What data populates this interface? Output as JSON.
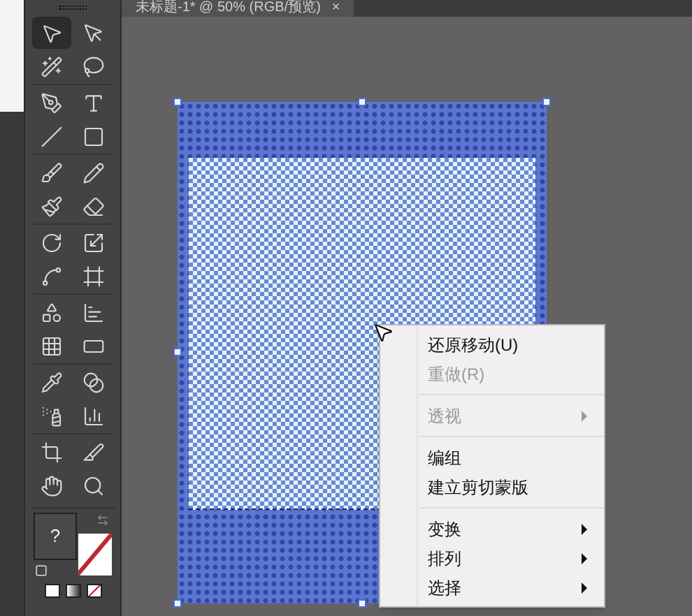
{
  "document_tab": {
    "title": "未标题-1* @ 50% (RGB/预览)",
    "close": "×"
  },
  "tools": [
    {
      "selected": true
    },
    {
      "selected": false
    },
    {
      "selected": false
    },
    {
      "selected": false
    },
    {
      "selected": false
    },
    {
      "selected": false
    },
    {
      "selected": false
    },
    {
      "selected": false
    },
    {
      "selected": false
    },
    {
      "selected": false
    },
    {
      "selected": false
    },
    {
      "selected": false
    },
    {
      "selected": false
    },
    {
      "selected": false
    },
    {
      "selected": false
    },
    {
      "selected": false
    },
    {
      "selected": false
    },
    {
      "selected": false
    },
    {
      "selected": false
    },
    {
      "selected": false
    },
    {
      "selected": false
    },
    {
      "selected": false
    },
    {
      "selected": false
    },
    {
      "selected": false
    },
    {
      "selected": false
    },
    {
      "selected": false
    },
    {
      "selected": false
    },
    {
      "selected": false
    }
  ],
  "fill": {
    "label": "?"
  },
  "context_menu": [
    {
      "kind": "item",
      "label": "还原移动(U)",
      "disabled": false,
      "submenu": false
    },
    {
      "kind": "item",
      "label": "重做(R)",
      "disabled": true,
      "submenu": false
    },
    {
      "kind": "separator"
    },
    {
      "kind": "item",
      "label": "透视",
      "disabled": true,
      "submenu": true
    },
    {
      "kind": "separator"
    },
    {
      "kind": "item",
      "label": "编组",
      "disabled": false,
      "submenu": false
    },
    {
      "kind": "item",
      "label": "建立剪切蒙版",
      "disabled": false,
      "submenu": false
    },
    {
      "kind": "separator"
    },
    {
      "kind": "item",
      "label": "变换",
      "disabled": false,
      "submenu": true
    },
    {
      "kind": "item",
      "label": "排列",
      "disabled": false,
      "submenu": true
    },
    {
      "kind": "item",
      "label": "选择",
      "disabled": false,
      "submenu": true
    }
  ]
}
